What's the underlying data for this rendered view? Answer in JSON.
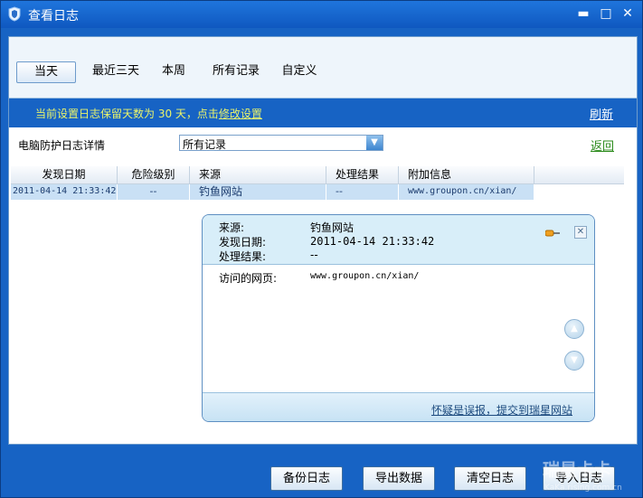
{
  "window": {
    "title": "查看日志",
    "min": "▬",
    "max": "□",
    "close": "✕"
  },
  "tabs": [
    "当天",
    "最近三天",
    "本周",
    "所有记录",
    "自定义"
  ],
  "info": {
    "prefix": "当前设置日志保留天数为 30 天，点击",
    "link": "修改设置",
    "refresh": "刷新"
  },
  "filter": {
    "label": "电脑防护日志详情",
    "selected": "所有记录",
    "back": "返回"
  },
  "table": {
    "headers": [
      "发现日期",
      "危险级别",
      "来源",
      "处理结果",
      "附加信息"
    ],
    "rows": [
      [
        "2011-04-14 21:33:42",
        "--",
        "钓鱼网站",
        "--",
        "www.groupon.cn/xian/"
      ]
    ]
  },
  "popup": {
    "fields": [
      {
        "key": "来源:",
        "value": "钓鱼网站"
      },
      {
        "key": "发现日期:",
        "value": "2011-04-14 21:33:42"
      },
      {
        "key": "处理结果:",
        "value": "--"
      }
    ],
    "body_key": "访问的网页:",
    "body_value": "www.groupon.cn/xian/",
    "report": "怀疑是误报，提交到瑞星网站"
  },
  "buttons": {
    "backup": "备份日志",
    "export": "导出数据",
    "clear": "清空日志",
    "import": "导入日志"
  },
  "watermark": {
    "line1": "瑞星卡卡",
    "line2": "KaKa.rising.com.cn"
  }
}
